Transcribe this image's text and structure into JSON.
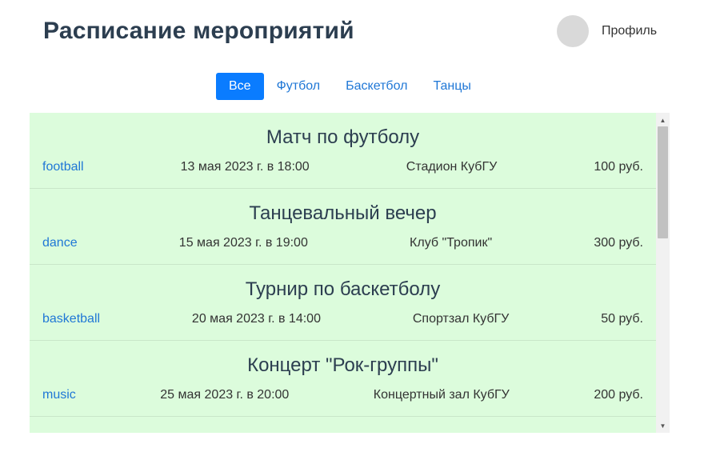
{
  "header": {
    "title": "Расписание мероприятий",
    "profile_label": "Профиль"
  },
  "tabs": [
    {
      "label": "Все",
      "active": true
    },
    {
      "label": "Футбол",
      "active": false
    },
    {
      "label": "Баскетбол",
      "active": false
    },
    {
      "label": "Танцы",
      "active": false
    }
  ],
  "events": [
    {
      "title": "Матч по футболу",
      "tag": "football",
      "date": "13 мая 2023 г. в 18:00",
      "place": "Стадион КубГУ",
      "price": "100 руб."
    },
    {
      "title": "Танцевальный вечер",
      "tag": "dance",
      "date": "15 мая 2023 г. в 19:00",
      "place": "Клуб \"Тропик\"",
      "price": "300 руб."
    },
    {
      "title": "Турнир по баскетболу",
      "tag": "basketball",
      "date": "20 мая 2023 г. в 14:00",
      "place": "Спортзал КубГУ",
      "price": "50 руб."
    },
    {
      "title": "Концерт \"Рок-группы\"",
      "tag": "music",
      "date": "25 мая 2023 г. в 20:00",
      "place": "Концертный зал КубГУ",
      "price": "200 руб."
    }
  ],
  "icons": {
    "scroll_up": "scroll-up-arrow-icon",
    "scroll_down": "scroll-down-arrow-icon"
  },
  "colors": {
    "accent": "#0a7cff",
    "link": "#1f77d6",
    "events_background": "#dcfcdc",
    "title": "#2c3e50"
  }
}
